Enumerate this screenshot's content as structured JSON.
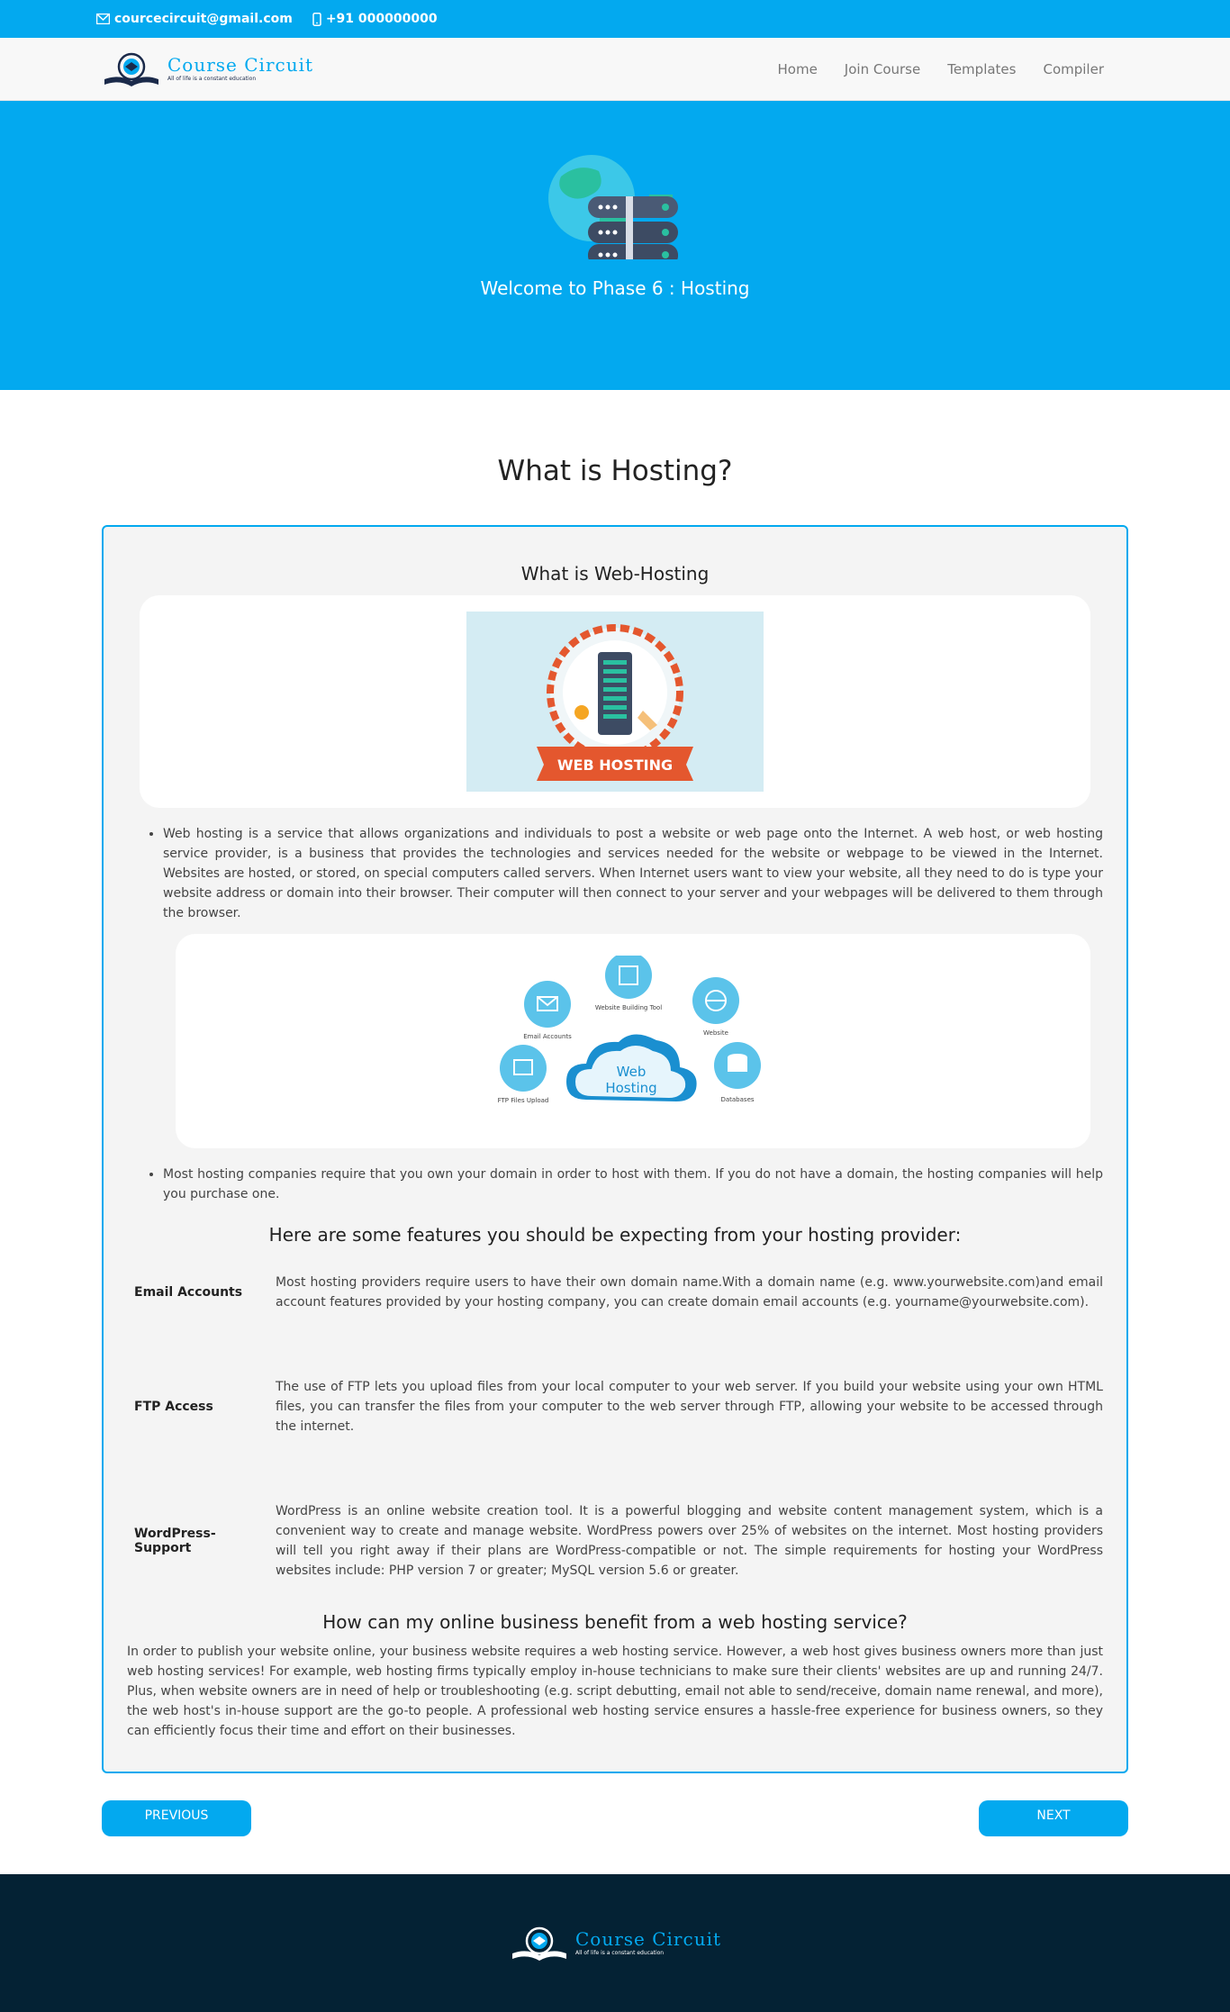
{
  "topbar": {
    "email": "courcecircuit@gmail.com",
    "phone": "+91 000000000",
    "email_icon": "envelope-icon",
    "phone_icon": "mobile-phone-icon"
  },
  "brand": {
    "name_first": "Course ",
    "name_second": "Circuit",
    "tagline": "All of life is a constant education"
  },
  "nav": {
    "items": [
      {
        "label": "Home"
      },
      {
        "label": "Join Course"
      },
      {
        "label": "Templates"
      },
      {
        "label": "Compiler"
      }
    ]
  },
  "hero": {
    "title": "Welcome to Phase 6 : Hosting",
    "icon": "globe-server-icon"
  },
  "main": {
    "section_title": "What is Hosting?",
    "card_title": "What is Web-Hosting",
    "badge_text": "WEB HOSTING",
    "bullet1": "Web hosting is a service that allows organizations and individuals to post a website or web page onto the Internet. A web host, or web hosting service provider, is a business that provides the technologies and services needed for the website or webpage to be viewed in the Internet. Websites are hosted, or stored, on special computers called servers. When Internet users want to view your website, all they need to do is type your website address or domain into their browser. Their computer will then connect to your server and your webpages will be delivered to them through the browser.",
    "diagram": {
      "center_line1": "Web",
      "center_line2": "Hosting",
      "email": "Email Accounts",
      "building": "Website Building Tool",
      "website": "Website",
      "ftp": "FTP Files Upload",
      "db": "Databases"
    },
    "bullet2": "Most hosting companies require that you own your domain in order to host with them. If you do not have a domain, the hosting companies will help you purchase one.",
    "features_title": "Here are some features you should be expecting from your hosting provider:",
    "features": [
      {
        "label": "Email Accounts",
        "text": "Most hosting providers require users to have their own domain name.With a domain name (e.g. www.yourwebsite.com)and email account features provided by your hosting company, you can create domain email accounts (e.g. yourname@yourwebsite.com)."
      },
      {
        "label": "FTP Access",
        "text": "The use of FTP lets you upload files from your local computer to your web server. If you build your website using your own HTML files, you can transfer the files from your computer to the web server through FTP, allowing your website to be accessed through the internet."
      },
      {
        "label": "WordPress- Support",
        "text": "WordPress is an online website creation tool. It is a powerful blogging and website content management system, which is a convenient way to create and manage website. WordPress powers over 25% of websites on the internet. Most hosting providers will tell you right away if their plans are WordPress-compatible or not. The simple requirements for hosting your WordPress websites include: PHP version 7 or greater; MySQL version 5.6 or greater."
      }
    ],
    "benefit_title": "How can my online business benefit from a web hosting service?",
    "benefit_text": "In order to publish your website online, your business website requires a web hosting service. However, a web host gives business owners more than just web hosting services! For example, web hosting firms typically employ in-house technicians to make sure their clients' websites are up and running 24/7. Plus, when website owners are in need of help or troubleshooting (e.g. script debutting, email not able to send/receive, domain name renewal, and more), the web host's in-house support are the go-to people. A professional web hosting service ensures a hassle-free experience for business owners, so they can efficiently focus their time and effort on their businesses."
  },
  "pager": {
    "previous": "PREVIOUS",
    "next": "NEXT"
  },
  "colors": {
    "accent": "#03a9ef",
    "footer": "#042234"
  }
}
